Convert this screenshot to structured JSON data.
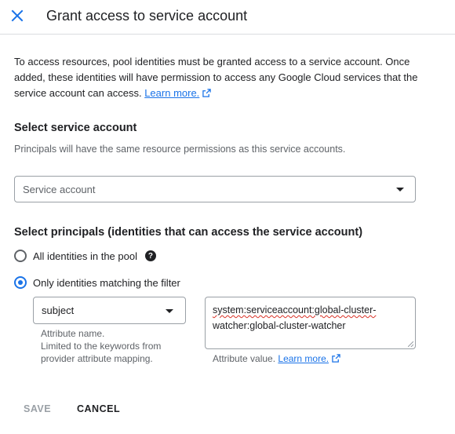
{
  "dialog": {
    "title": "Grant access to service account",
    "description": "To access resources, pool identities must be granted access to a service account. Once added, these identities will have permission to access any Google Cloud services that the service account can access.",
    "learn_more": "Learn more."
  },
  "service_account_section": {
    "heading": "Select service account",
    "subtext": "Principals will have the same resource permissions as this service accounts.",
    "select_placeholder": "Service account"
  },
  "principals_section": {
    "heading": "Select principals (identities that can access the service account)",
    "option_all": "All identities in the pool",
    "option_filter": "Only identities matching the filter",
    "selected": "filter",
    "attribute_name": {
      "value": "subject",
      "hint_line1": "Attribute name.",
      "hint_line2": "Limited to the keywords from",
      "hint_line3": "provider attribute mapping."
    },
    "attribute_value": {
      "value_part1": "system:serviceaccount:global-cluster-",
      "value_part2": "watcher:global-cluster-watcher",
      "hint": "Attribute value.",
      "learn_more": "Learn more."
    }
  },
  "actions": {
    "save": "SAVE",
    "cancel": "CANCEL"
  },
  "colors": {
    "accent": "#1a73e8",
    "disabled": "#9aa0a6",
    "border": "#dadce0"
  }
}
